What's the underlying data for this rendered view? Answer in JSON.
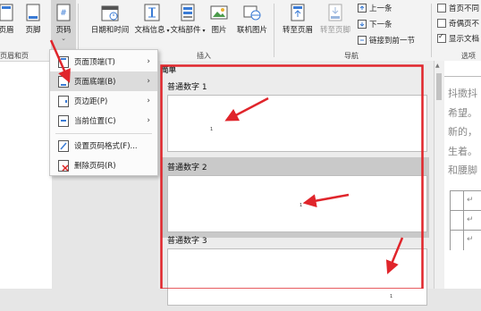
{
  "ribbon": {
    "buttons_left": [
      {
        "label": "页眉",
        "icon": "header-icon"
      },
      {
        "label": "页脚",
        "icon": "footer-icon"
      },
      {
        "label": "页码",
        "icon": "page-number-icon"
      }
    ],
    "group_header_footer": "页眉和页",
    "insert_buttons": [
      {
        "label": "日期和时间",
        "icon": "calendar-icon"
      },
      {
        "label": "文档信息",
        "icon": "document-info-icon"
      },
      {
        "label": "文档部件",
        "icon": "document-parts-icon"
      },
      {
        "label": "图片",
        "icon": "picture-icon"
      },
      {
        "label": "联机图片",
        "icon": "online-picture-icon"
      }
    ],
    "group_insert": "插入",
    "nav_buttons": [
      {
        "label": "转至页眉",
        "icon": "goto-header-icon"
      },
      {
        "label": "转至页脚",
        "icon": "goto-footer-icon"
      }
    ],
    "nav_small": [
      {
        "label": "上一条",
        "icon": "previous-icon"
      },
      {
        "label": "下一条",
        "icon": "next-icon"
      },
      {
        "label": "链接到前一节",
        "icon": "link-icon"
      }
    ],
    "group_nav": "导航",
    "options": [
      {
        "label": "首页不同",
        "checked": false
      },
      {
        "label": "奇偶页不",
        "checked": false
      },
      {
        "label": "显示文档",
        "checked": true
      }
    ],
    "group_options": "选项"
  },
  "menu": {
    "items": [
      {
        "label": "页面顶端(T)",
        "icon": "page-top-icon",
        "submenu": true,
        "highlighted": false
      },
      {
        "label": "页面底端(B)",
        "icon": "page-bottom-icon",
        "submenu": true,
        "highlighted": true
      },
      {
        "label": "页边距(P)",
        "icon": "page-margin-icon",
        "submenu": true,
        "highlighted": false
      },
      {
        "label": "当前位置(C)",
        "icon": "current-position-icon",
        "submenu": true,
        "highlighted": false
      },
      {
        "label": "设置页码格式(F)...",
        "icon": "format-page-number-icon",
        "submenu": false,
        "highlighted": false
      },
      {
        "label": "删除页码(R)",
        "icon": "remove-page-number-icon",
        "submenu": false,
        "highlighted": false
      }
    ]
  },
  "gallery": {
    "section": "简单",
    "items": [
      {
        "title": "普通数字 1",
        "number": "1",
        "selected": false
      },
      {
        "title": "普通数字 2",
        "number": "1",
        "selected": true
      },
      {
        "title": "普通数字 3",
        "number": "1",
        "selected": false
      }
    ]
  },
  "document": {
    "lines": [
      "抖擞抖",
      "希望。",
      "新的，",
      "生着。",
      "和腰脚"
    ],
    "cell_mark": "↵"
  },
  "colors": {
    "annotation_red": "#e0252b",
    "ribbon_bg": "#f3f3f3",
    "selection_gray": "#c9c9c9"
  }
}
